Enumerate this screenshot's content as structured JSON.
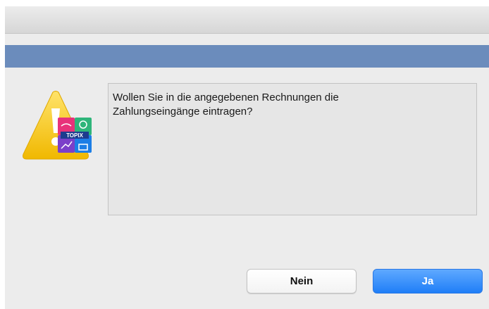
{
  "dialog": {
    "message_line1": "Wollen Sie in die angegebenen Rechnungen die",
    "message_line2": "Zahlungseingänge eintragen?",
    "icon": "warning-triangle-topix-icon",
    "logo_text": "TOPIX"
  },
  "buttons": {
    "no_label": "Nein",
    "yes_label": "Ja"
  },
  "colors": {
    "header_band": "#6b8cbc",
    "warning_yellow": "#f2c21a",
    "primary_button": "#2a84f8"
  }
}
